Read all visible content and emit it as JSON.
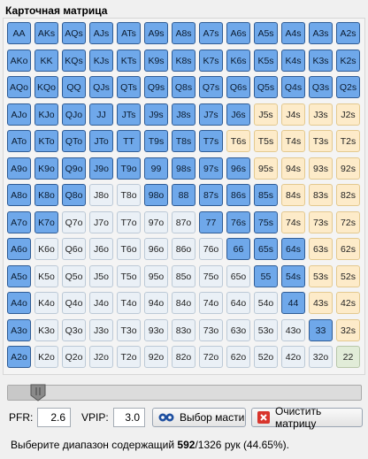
{
  "title": "Карточная матрица",
  "matrix": {
    "rows": [
      [
        "AA",
        "AKs",
        "AQs",
        "AJs",
        "ATs",
        "A9s",
        "A8s",
        "A7s",
        "A6s",
        "A5s",
        "A4s",
        "A3s",
        "A2s"
      ],
      [
        "AKo",
        "KK",
        "KQs",
        "KJs",
        "KTs",
        "K9s",
        "K8s",
        "K7s",
        "K6s",
        "K5s",
        "K4s",
        "K3s",
        "K2s"
      ],
      [
        "AQo",
        "KQo",
        "QQ",
        "QJs",
        "QTs",
        "Q9s",
        "Q8s",
        "Q7s",
        "Q6s",
        "Q5s",
        "Q4s",
        "Q3s",
        "Q2s"
      ],
      [
        "AJo",
        "KJo",
        "QJo",
        "JJ",
        "JTs",
        "J9s",
        "J8s",
        "J7s",
        "J6s",
        "J5s",
        "J4s",
        "J3s",
        "J2s"
      ],
      [
        "ATo",
        "KTo",
        "QTo",
        "JTo",
        "TT",
        "T9s",
        "T8s",
        "T7s",
        "T6s",
        "T5s",
        "T4s",
        "T3s",
        "T2s"
      ],
      [
        "A9o",
        "K9o",
        "Q9o",
        "J9o",
        "T9o",
        "99",
        "98s",
        "97s",
        "96s",
        "95s",
        "94s",
        "93s",
        "92s"
      ],
      [
        "A8o",
        "K8o",
        "Q8o",
        "J8o",
        "T8o",
        "98o",
        "88",
        "87s",
        "86s",
        "85s",
        "84s",
        "83s",
        "82s"
      ],
      [
        "A7o",
        "K7o",
        "Q7o",
        "J7o",
        "T7o",
        "97o",
        "87o",
        "77",
        "76s",
        "75s",
        "74s",
        "73s",
        "72s"
      ],
      [
        "A6o",
        "K6o",
        "Q6o",
        "J6o",
        "T6o",
        "96o",
        "86o",
        "76o",
        "66",
        "65s",
        "64s",
        "63s",
        "62s"
      ],
      [
        "A5o",
        "K5o",
        "Q5o",
        "J5o",
        "T5o",
        "95o",
        "85o",
        "75o",
        "65o",
        "55",
        "54s",
        "53s",
        "52s"
      ],
      [
        "A4o",
        "K4o",
        "Q4o",
        "J4o",
        "T4o",
        "94o",
        "84o",
        "74o",
        "64o",
        "54o",
        "44",
        "43s",
        "42s"
      ],
      [
        "A3o",
        "K3o",
        "Q3o",
        "J3o",
        "T3o",
        "93o",
        "83o",
        "73o",
        "63o",
        "53o",
        "43o",
        "33",
        "32s"
      ],
      [
        "A2o",
        "K2o",
        "Q2o",
        "J2o",
        "T2o",
        "92o",
        "82o",
        "72o",
        "62o",
        "52o",
        "42o",
        "32o",
        "22"
      ]
    ],
    "selected": [
      [
        1,
        1,
        1,
        1,
        1,
        1,
        1,
        1,
        1,
        1,
        1,
        1,
        1
      ],
      [
        1,
        1,
        1,
        1,
        1,
        1,
        1,
        1,
        1,
        1,
        1,
        1,
        1
      ],
      [
        1,
        1,
        1,
        1,
        1,
        1,
        1,
        1,
        1,
        1,
        1,
        1,
        1
      ],
      [
        1,
        1,
        1,
        1,
        1,
        1,
        1,
        1,
        1,
        0,
        0,
        0,
        0
      ],
      [
        1,
        1,
        1,
        1,
        1,
        1,
        1,
        1,
        0,
        0,
        0,
        0,
        0
      ],
      [
        1,
        1,
        1,
        1,
        1,
        1,
        1,
        1,
        1,
        0,
        0,
        0,
        0
      ],
      [
        1,
        1,
        1,
        0,
        0,
        1,
        1,
        1,
        1,
        1,
        0,
        0,
        0
      ],
      [
        1,
        1,
        0,
        0,
        0,
        0,
        0,
        1,
        1,
        1,
        0,
        0,
        0
      ],
      [
        1,
        0,
        0,
        0,
        0,
        0,
        0,
        0,
        1,
        1,
        1,
        0,
        0
      ],
      [
        1,
        0,
        0,
        0,
        0,
        0,
        0,
        0,
        0,
        1,
        1,
        0,
        0
      ],
      [
        1,
        0,
        0,
        0,
        0,
        0,
        0,
        0,
        0,
        0,
        1,
        0,
        0
      ],
      [
        1,
        0,
        0,
        0,
        0,
        0,
        0,
        0,
        0,
        0,
        0,
        1,
        0
      ],
      [
        1,
        0,
        0,
        0,
        0,
        0,
        0,
        0,
        0,
        0,
        0,
        0,
        0
      ]
    ]
  },
  "colors": {
    "selected": "#6fa8ea",
    "pair": "#e1ecd8",
    "suited": "#fdebc9",
    "offsuit": "#eaf0f6"
  },
  "slider": {
    "value_fraction": 0.06
  },
  "pfr": {
    "label": "PFR:",
    "value": "2.6"
  },
  "vpip": {
    "label": "VPIP:",
    "value": "3.0"
  },
  "buttons": {
    "suit_select": {
      "label": "Выбор масти",
      "icon": "suits-icon"
    },
    "clear_matrix": {
      "label": "Очистить матрицу",
      "icon": "close-x-icon"
    }
  },
  "status": {
    "prefix": "Выберите диапазон содержащий ",
    "count": "592",
    "suffix": "/1326 рук (44.65%)."
  }
}
